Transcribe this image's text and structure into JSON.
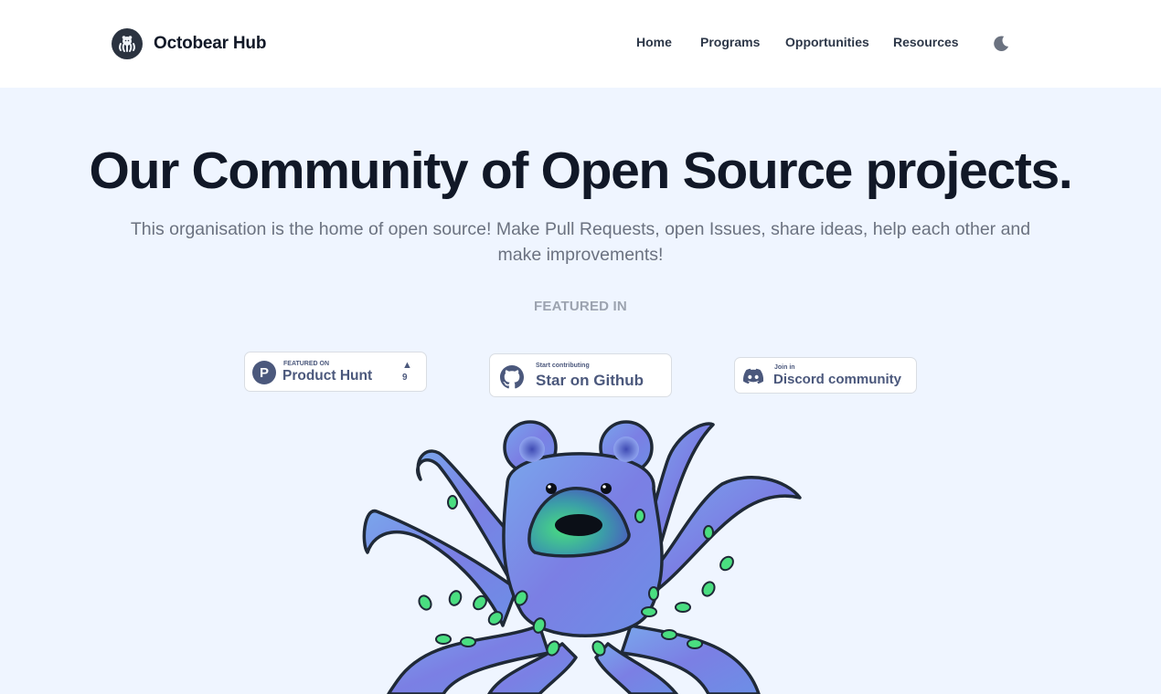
{
  "header": {
    "brand_name": "Octobear Hub",
    "logo_icon": "octopus-logo-icon",
    "nav": [
      {
        "label": "Home"
      },
      {
        "label": "Programs"
      },
      {
        "label": "Opportunities"
      },
      {
        "label": "Resources"
      }
    ],
    "theme_toggle_icon": "moon-icon"
  },
  "hero": {
    "title": "Our Community of Open Source projects.",
    "subtitle": "This organisation is the home of open source! Make Pull Requests, open Issues, share ideas, help each other and make improvements!",
    "featured_label": "FEATURED IN"
  },
  "badges": {
    "product_hunt": {
      "small": "FEATURED ON",
      "big": "Product Hunt",
      "letter": "P",
      "arrow": "▲",
      "count": "9",
      "icon": "product-hunt-icon"
    },
    "github": {
      "small": "Start contributing",
      "big": "Star on Github",
      "icon": "github-icon"
    },
    "discord": {
      "small": "Join in",
      "big": "Discord community",
      "icon": "discord-icon"
    }
  },
  "colors": {
    "page_bg": "#eff5ff",
    "header_bg": "#ffffff",
    "title": "#111827",
    "subtitle": "#6b7280",
    "badge_text": "#4b587c",
    "octopus_body": "#7b7fe4",
    "octopus_spots": "#4ade80"
  }
}
